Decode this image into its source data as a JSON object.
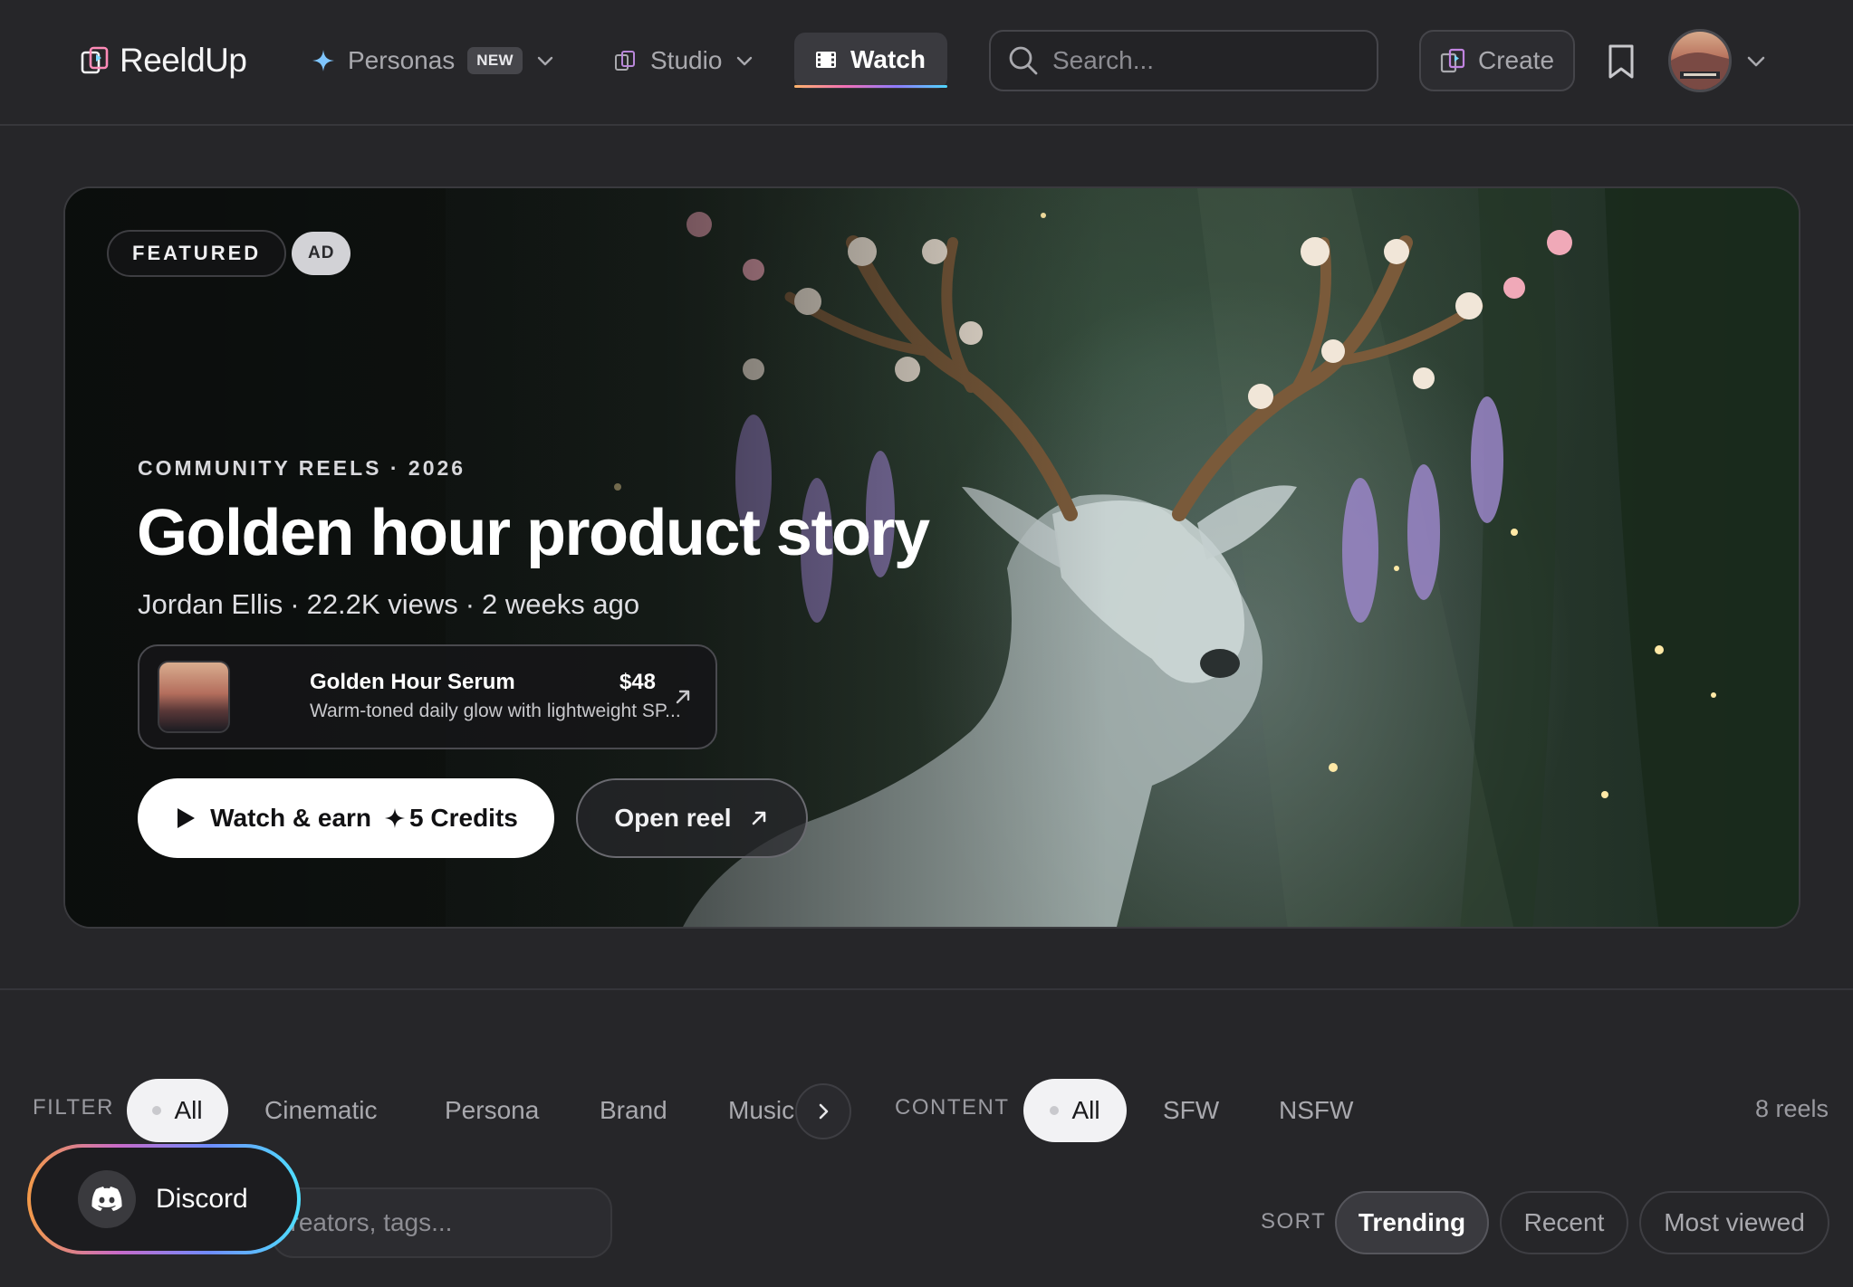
{
  "app": {
    "name": "ReeldUp"
  },
  "nav": {
    "personas_label": "Personas",
    "personas_badge": "NEW",
    "studio_label": "Studio",
    "watch_label": "Watch",
    "search_placeholder": "Search...",
    "create_label": "Create"
  },
  "hero": {
    "featured_label": "FEATURED",
    "ad_label": "AD",
    "eyebrow": "COMMUNITY REELS · 2026",
    "title": "Golden hour product story",
    "author": "Jordan Ellis",
    "views": "22.2K views",
    "age": "2 weeks ago",
    "separator": "·",
    "product": {
      "name": "Golden Hour Serum",
      "price": "$48",
      "description": "Warm-toned daily glow with lightweight SP..."
    },
    "watch_button": "Watch & earn",
    "watch_reward": "5 Credits",
    "open_button": "Open reel"
  },
  "filters": {
    "filter_label": "FILTER",
    "categories": [
      "All",
      "Cinematic",
      "Persona",
      "Brand",
      "Music"
    ],
    "active_category": "All",
    "content_label": "CONTENT",
    "content_options": [
      "All",
      "SFW",
      "NSFW"
    ],
    "active_content": "All",
    "reels_count": "8 reels",
    "search_placeholder": "Search creators, tags..."
  },
  "sort": {
    "label": "SORT",
    "options": [
      "Trending",
      "Recent",
      "Most viewed"
    ],
    "active": "Trending"
  },
  "discord": {
    "label": "Discord"
  },
  "colors": {
    "background": "#262629",
    "accent_gradient": [
      "#ffb36b",
      "#f26fb6",
      "#8f7bff",
      "#4fd6ff"
    ],
    "primary_button": "#ffffff"
  }
}
